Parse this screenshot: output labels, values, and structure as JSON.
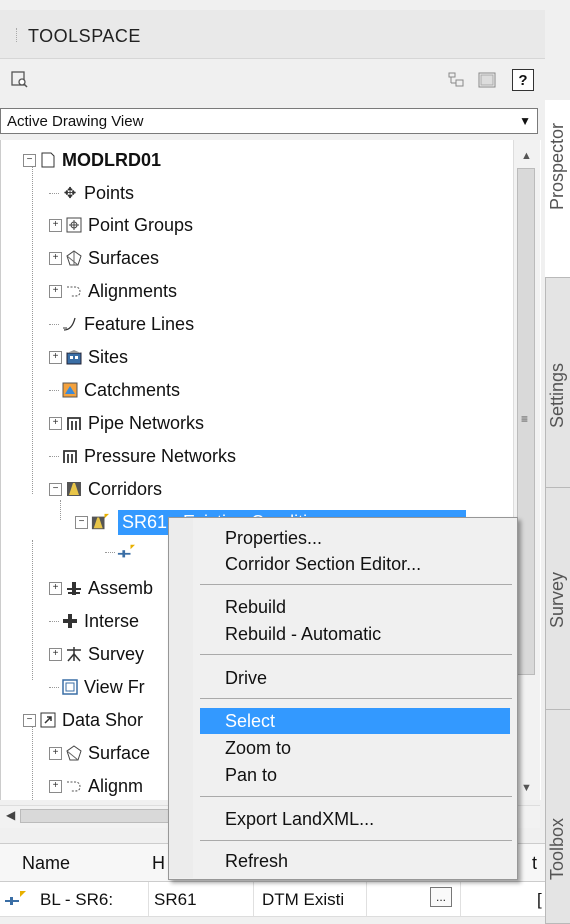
{
  "panel": {
    "title": "TOOLSPACE"
  },
  "toolbar": {
    "help_label": "?"
  },
  "view_select": {
    "value": "Active Drawing View"
  },
  "tree": {
    "root": "MODLRD01",
    "items": [
      "Points",
      "Point Groups",
      "Surfaces",
      "Alignments",
      "Feature Lines",
      "Sites",
      "Catchments",
      "Pipe Networks",
      "Pressure Networks",
      "Corridors"
    ],
    "corridor_child": "SR61 - Existing Conditi",
    "more_items": [
      "Assemb",
      "Interse",
      "Survey",
      "View Fr"
    ],
    "data_shortcuts": "Data Shor",
    "ds_items": [
      "Surface",
      "Alignm"
    ]
  },
  "tabs": {
    "prospector": "Prospector",
    "settings": "Settings",
    "survey": "Survey",
    "toolbox": "Toolbox"
  },
  "grid": {
    "headers": {
      "name": "Name",
      "col2": "H",
      "col_last": "t"
    },
    "row": {
      "name": "BL - SR6:",
      "c2": "SR61",
      "c3": "DTM Existi",
      "ellipsis": "...",
      "c5": "["
    }
  },
  "context_menu": {
    "items": [
      "Properties...",
      "Corridor Section Editor...",
      "Rebuild",
      "Rebuild - Automatic",
      "Drive",
      "Select",
      "Zoom to",
      "Pan to",
      "Export LandXML...",
      "Refresh"
    ]
  },
  "colors": {
    "selection": "#3399ff",
    "panel_bg": "#f0f0f0"
  },
  "icons": {
    "search": "search-icon",
    "tb2": "tree-view-icon",
    "tb3": "panel-icon"
  }
}
